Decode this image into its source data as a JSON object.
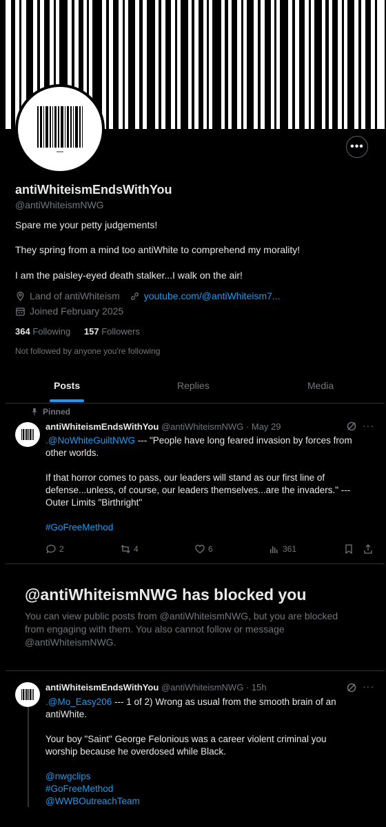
{
  "profile": {
    "display_name": "antiWhiteismEndsWithYou",
    "handle": "@antiWhiteismNWG",
    "bio_lines": [
      "Spare me your petty judgements!",
      "They spring from a mind too antiWhite to comprehend my morality!",
      "I am the paisley-eyed death stalker...I walk on the air!"
    ],
    "location": "Land of antiWhiteism",
    "website": "youtube.com/@antiWhiteism7...",
    "joined": "Joined February 2025",
    "following_count": "364",
    "following_label": "Following",
    "followers_count": "157",
    "followers_label": "Followers",
    "not_followed": "Not followed by anyone you're following",
    "more_icon": "ellipsis-icon"
  },
  "tabs": [
    {
      "label": "Posts",
      "active": true
    },
    {
      "label": "Replies",
      "active": false
    },
    {
      "label": "Media",
      "active": false
    }
  ],
  "pinned_post": {
    "pinned_label": "Pinned",
    "author": "antiWhiteismEndsWithYou",
    "handle_date": "@antiWhiteismNWG · May 29",
    "mention": ".@NoWhiteGuiltNWG",
    "line1_rest": " --- \"People have long feared invasion by forces from",
    "line2": "other worlds.",
    "para2_l1": "If that horror comes to pass, our leaders will stand as our first line of",
    "para2_l2": "defense...unless, of course, our leaders themselves...are the invaders.\" ---",
    "para2_l3": "Outer Limits \"Birthright\"",
    "hashtag": "#GoFreeMethod",
    "replies": "2",
    "reposts": "4",
    "likes": "6",
    "views": "361"
  },
  "blocked": {
    "title": "@antiWhiteismNWG has blocked you",
    "body": "You can view public posts from @antiWhiteismNWG, but you are blocked from engaging with them. You also cannot follow or message @antiWhiteismNWG."
  },
  "second_post": {
    "author": "antiWhiteismEndsWithYou",
    "handle_date": "@antiWhiteismNWG · 15h",
    "mention": ".@Mo_Easy206",
    "line1_rest": " --- 1 of 2) Wrong as usual from the smooth brain of an",
    "line2": "antiWhite.",
    "para2_l1": "Your boy \"Saint\" George Felonious was a career violent criminal you",
    "para2_l2": "worship because he overdosed while Black.",
    "tag1": "@nwgclips",
    "tag2": "#GoFreeMethod",
    "tag3": "@WWBOutreachTeam"
  },
  "colors": {
    "accent": "#1d9bf0",
    "muted": "#71767b",
    "text": "#e7e9ea",
    "border": "#2f3336"
  }
}
